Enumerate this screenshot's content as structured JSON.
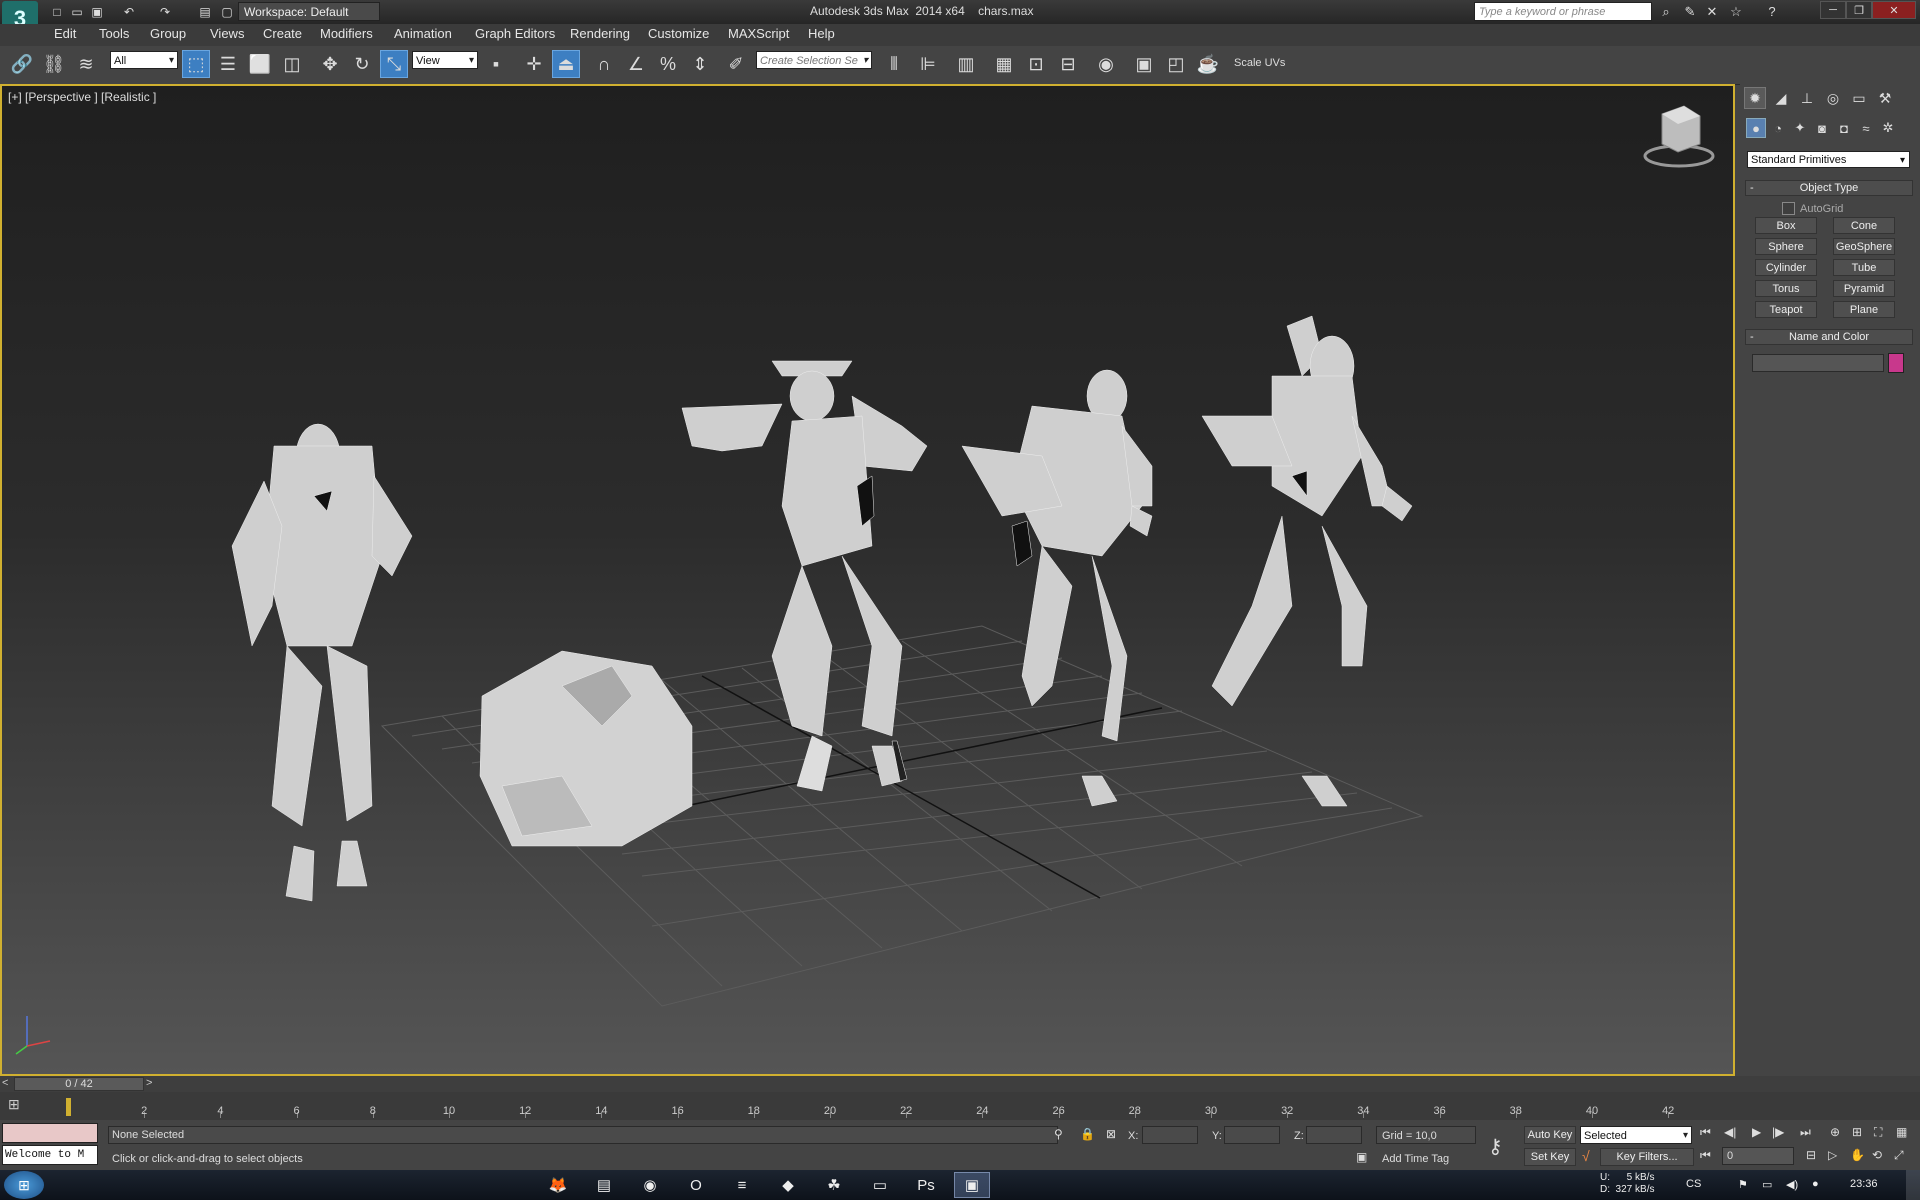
{
  "titlebar": {
    "workspace": "Workspace: Default",
    "app_title": "Autodesk 3ds Max  2014 x64",
    "file_name": "chars.max",
    "search_placeholder": "Type a keyword or phrase"
  },
  "menubar": [
    "Edit",
    "Tools",
    "Group",
    "Views",
    "Create",
    "Modifiers",
    "Animation",
    "Graph Editors",
    "Rendering",
    "Customize",
    "MAXScript",
    "Help"
  ],
  "toolbar": {
    "selection_filter": "All",
    "ref_coord": "View",
    "named_selection": "Create Selection Se",
    "scale_uvs": "Scale UVs"
  },
  "viewport": {
    "label": "[+] [Perspective ] [Realistic ]"
  },
  "command_panel": {
    "category": "Standard Primitives",
    "object_type_title": "Object Type",
    "autogrid": "AutoGrid",
    "buttons": [
      "Box",
      "Cone",
      "Sphere",
      "GeoSphere",
      "Cylinder",
      "Tube",
      "Torus",
      "Pyramid",
      "Teapot",
      "Plane"
    ],
    "name_color_title": "Name and Color",
    "color": "#c8388c"
  },
  "timeline": {
    "frame_display": "0 / 42",
    "ticks": [
      "2",
      "4",
      "6",
      "8",
      "10",
      "12",
      "14",
      "16",
      "18",
      "20",
      "22",
      "24",
      "26",
      "28",
      "30",
      "32",
      "34",
      "36",
      "38",
      "40",
      "42"
    ]
  },
  "status": {
    "listener": "Welcome to M",
    "selection": "None Selected",
    "prompt": "Click or click-and-drag to select objects",
    "x_label": "X:",
    "y_label": "Y:",
    "z_label": "Z:",
    "grid": "Grid = 10,0",
    "add_time_tag": "Add Time Tag",
    "auto_key": "Auto Key",
    "set_key": "Set Key",
    "key_mode": "Selected",
    "key_filters": "Key Filters...",
    "frame_field": "0"
  },
  "taskbar": {
    "net_up": "U:      5 kB/s",
    "net_down": "D:  327 kB/s",
    "lang": "CS",
    "clock": "23:36"
  }
}
